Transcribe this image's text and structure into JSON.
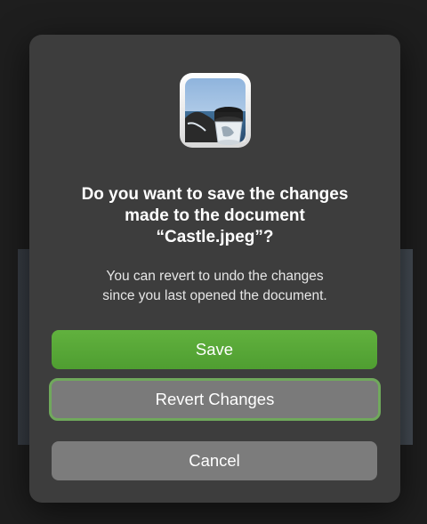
{
  "dialog": {
    "app_icon": "preview-app-icon",
    "title_line1": "Do you want to save the changes",
    "title_line2": "made to the document",
    "title_line3": "“Castle.jpeg”?",
    "message_line1": "You can revert to undo the changes",
    "message_line2": "since you last opened the document.",
    "buttons": {
      "save": "Save",
      "revert": "Revert Changes",
      "cancel": "Cancel"
    }
  },
  "colors": {
    "dialog_bg": "#3d3d3d",
    "save_button": "#56a635",
    "secondary_button": "#7a7a7a",
    "focus_ring": "#70a95c"
  }
}
